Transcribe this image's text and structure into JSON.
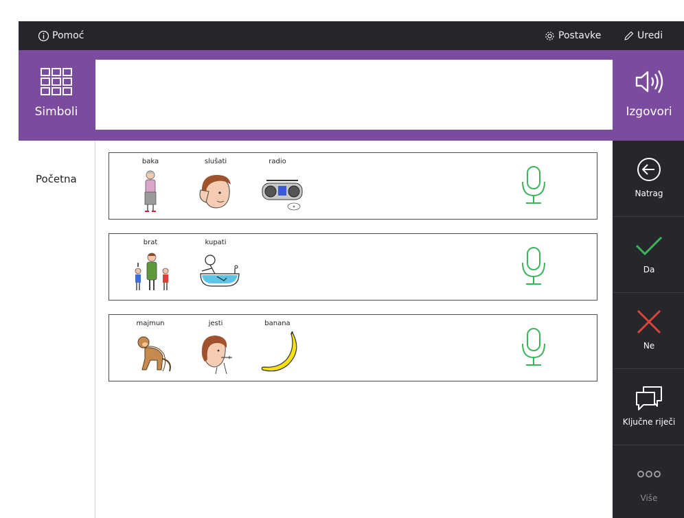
{
  "topbar": {
    "help_label": "Pomoć",
    "settings_label": "Postavke",
    "edit_label": "Uredi"
  },
  "band": {
    "symbols_label": "Simboli",
    "speak_label": "Izgovori",
    "message_text": ""
  },
  "categories": [
    {
      "label": "Početna"
    }
  ],
  "phrases": [
    {
      "words": [
        "baka",
        "slušati",
        "radio"
      ],
      "icons": [
        "grandmother-icon",
        "listen-icon",
        "radio-icon"
      ]
    },
    {
      "words": [
        "brat",
        "kupati"
      ],
      "icons": [
        "brother-icon",
        "bathe-icon"
      ]
    },
    {
      "words": [
        "majmun",
        "jesti",
        "banana"
      ],
      "icons": [
        "monkey-icon",
        "eat-icon",
        "banana-icon"
      ]
    }
  ],
  "actions": [
    {
      "label": "Natrag",
      "icon": "back-arrow-icon"
    },
    {
      "label": "Da",
      "icon": "check-icon"
    },
    {
      "label": "Ne",
      "icon": "cross-icon"
    },
    {
      "label": "Ključne riječi",
      "icon": "speech-bubbles-icon"
    },
    {
      "label": "Više",
      "icon": "more-dots-icon"
    }
  ],
  "colors": {
    "topbar": "#25262b",
    "accent_purple": "#7b4b9e",
    "mic_green": "#3cb35a",
    "yes_green": "#3cb35a",
    "no_red": "#e0453a",
    "sidebar_dark": "#26272c"
  }
}
